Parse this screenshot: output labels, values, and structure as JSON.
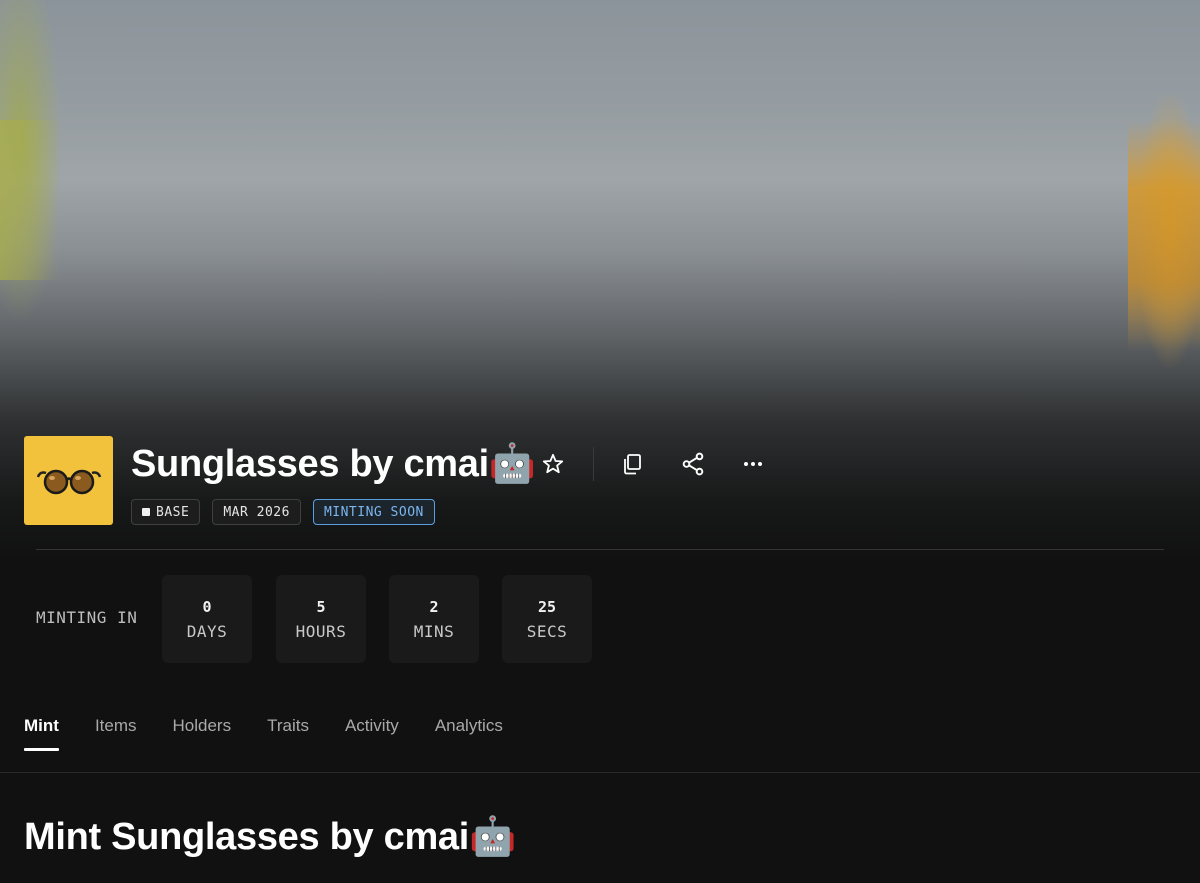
{
  "collection": {
    "title": "Sunglasses by cmai🤖",
    "avatar_icon": "sunglasses-icon",
    "avatar_bg": "#f2c23c"
  },
  "actions": {
    "favorite_icon": "star-icon",
    "copy_icon": "copy-icon",
    "share_icon": "share-icon",
    "more_icon": "more-horizontal-icon"
  },
  "badges": {
    "chain": "BASE",
    "date": "MAR 2026",
    "status": "MINTING SOON",
    "status_color": "#5aa0e0"
  },
  "countdown": {
    "label": "MINTING IN",
    "days_value": "0",
    "days_unit": "DAYS",
    "hours_value": "5",
    "hours_unit": "HOURS",
    "mins_value": "2",
    "mins_unit": "MINS",
    "secs_value": "25",
    "secs_unit": "SECS"
  },
  "tabs": [
    {
      "label": "Mint",
      "active": true
    },
    {
      "label": "Items",
      "active": false
    },
    {
      "label": "Holders",
      "active": false
    },
    {
      "label": "Traits",
      "active": false
    },
    {
      "label": "Activity",
      "active": false
    },
    {
      "label": "Analytics",
      "active": false
    }
  ],
  "section": {
    "title": "Mint Sunglasses by cmai🤖"
  }
}
